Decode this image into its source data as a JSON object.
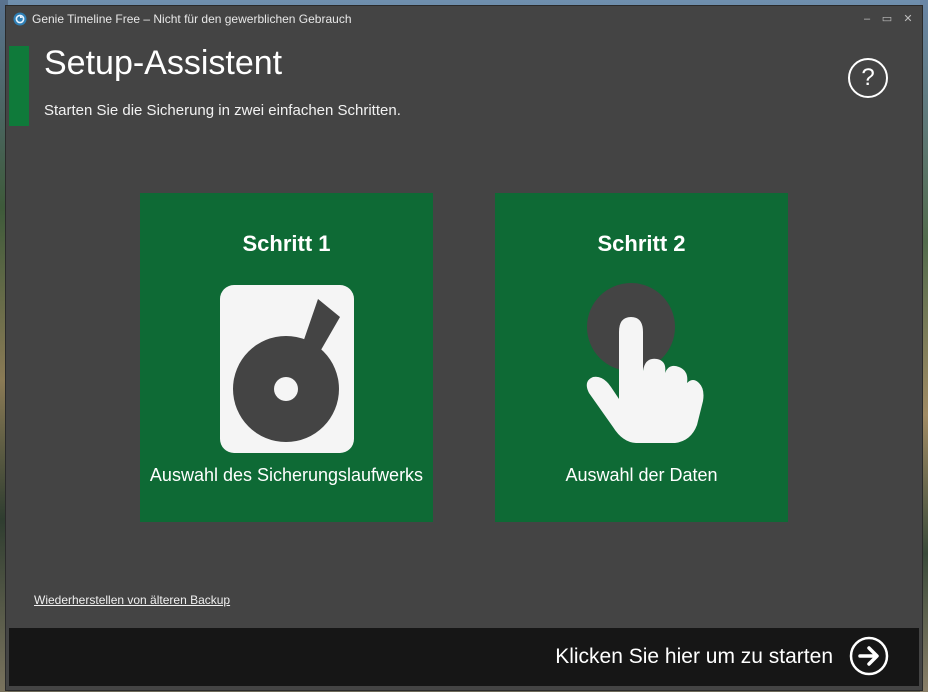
{
  "window": {
    "title": "Genie Timeline Free – Nicht für den gewerblichen Gebrauch",
    "controls": {
      "minimize": "–",
      "maximize": "▭",
      "close": "✕"
    }
  },
  "header": {
    "title": "Setup-Assistent",
    "subtitle": "Starten Sie die Sicherung in zwei einfachen Schritten.",
    "help_symbol": "?"
  },
  "steps": [
    {
      "title": "Schritt 1",
      "label": "Auswahl des Sicherungslaufwerks",
      "icon": "hard-drive-icon"
    },
    {
      "title": "Schritt 2",
      "label": "Auswahl der Daten",
      "icon": "tap-hand-icon"
    }
  ],
  "links": {
    "restore": "Wiederherstellen von älteren Backup"
  },
  "footer": {
    "start_label": "Klicken Sie hier um zu starten",
    "start_icon": "arrow-right-circle-icon"
  },
  "colors": {
    "window_bg": "#444444",
    "accent_green": "#0f7a3a",
    "card_green": "#0e6a35",
    "footer_bg": "#161616",
    "icon_white": "#f5f5f5"
  }
}
